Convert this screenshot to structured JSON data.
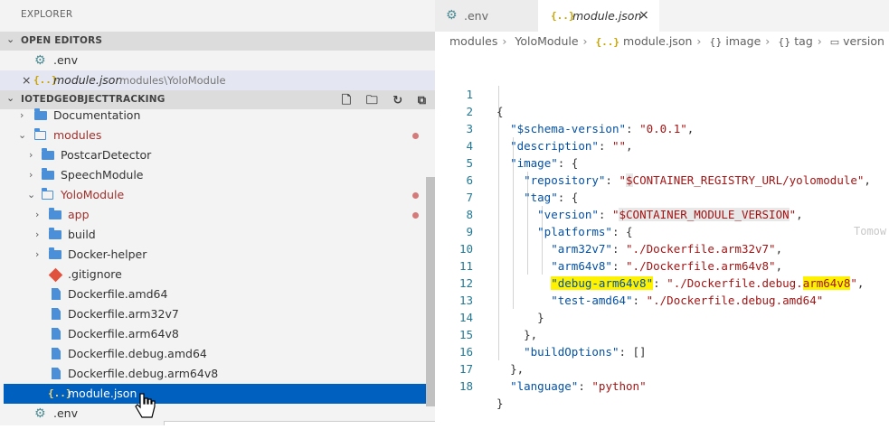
{
  "explorer": {
    "title": "EXPLORER",
    "open_editors": {
      "header": "OPEN EDITORS",
      "items": [
        {
          "name": ".env",
          "path": ""
        },
        {
          "name": "module.json",
          "path": "modules\\YoloModule",
          "close": "×",
          "icon": "{..}"
        }
      ]
    },
    "project": {
      "header": "IOTEDGEOBJECTTRACKING",
      "tree": [
        {
          "label": "Documentation"
        },
        {
          "label": "modules"
        },
        {
          "label": "PostcarDetector"
        },
        {
          "label": "SpeechModule"
        },
        {
          "label": "YoloModule"
        },
        {
          "label": "app"
        },
        {
          "label": "build"
        },
        {
          "label": "Docker-helper"
        },
        {
          "label": ".gitignore"
        },
        {
          "label": "Dockerfile.amd64"
        },
        {
          "label": "Dockerfile.arm32v7"
        },
        {
          "label": "Dockerfile.arm64v8"
        },
        {
          "label": "Dockerfile.debug.amd64"
        },
        {
          "label": "Dockerfile.debug.arm64v8"
        },
        {
          "label": "module.json",
          "icon": "{..}"
        },
        {
          "label": ".env"
        }
      ]
    }
  },
  "tabs": [
    {
      "label": ".env"
    },
    {
      "label": "module.json",
      "close": "×",
      "icon": "{..}"
    }
  ],
  "breadcrumb": [
    "modules",
    "YoloModule",
    "module.json",
    "image",
    "tag",
    "version"
  ],
  "editor": {
    "line_numbers": [
      "1",
      "2",
      "3",
      "4",
      "5",
      "6",
      "7",
      "8",
      "9",
      "10",
      "11",
      "12",
      "13",
      "14",
      "15",
      "16",
      "17",
      "18"
    ],
    "ghost_text": "Tomow",
    "lines": {
      "l1": "{",
      "l2_key": "\"$schema-version\"",
      "l2_val": "\"0.0.1\"",
      "l3_key": "\"description\"",
      "l3_val": "\"\"",
      "l4_key": "\"image\"",
      "l4_rest": ": {",
      "l5_key": "\"repository\"",
      "l5_q": "\"",
      "l5_dollar": "$",
      "l5_val": "CONTAINER_REGISTRY_URL/yolomodule\"",
      "l6_key": "\"tag\"",
      "l6_rest": ": {",
      "l7_key": "\"version\"",
      "l7_q": "\"",
      "l7_dollar": "$",
      "l7_val": "CONTAINER_MODULE_VERSION",
      "l7_end": "\"",
      "l8_key": "\"platforms\"",
      "l8_rest": ": {",
      "l9_key": "\"arm32v7\"",
      "l9_val": "\"./Dockerfile.arm32v7\"",
      "l10_key": "\"arm64v8\"",
      "l10_val": "\"./Dockerfile.arm64v8\"",
      "l11_key": "\"debug-arm64v8\"",
      "l11_val_a": "\"./Dockerfile.debug.",
      "l11_val_b": "arm64v8",
      "l11_val_c": "\"",
      "l12_key": "\"test-amd64\"",
      "l12_val": "\"./Dockerfile.debug.amd64\"",
      "l13": "}",
      "l14": "},",
      "l15_key": "\"buildOptions\"",
      "l15_rest": ": []",
      "l16": "},",
      "l17_key": "\"language\"",
      "l17_val": "\"python\"",
      "l18": "}"
    }
  },
  "colors": {
    "selection": "#0060c0",
    "modified_dot": "#d47a7a",
    "highlight": "#fff200",
    "folder_icon": "#4a8fd8",
    "json_key": "#0451a5",
    "json_string": "#a31515"
  }
}
